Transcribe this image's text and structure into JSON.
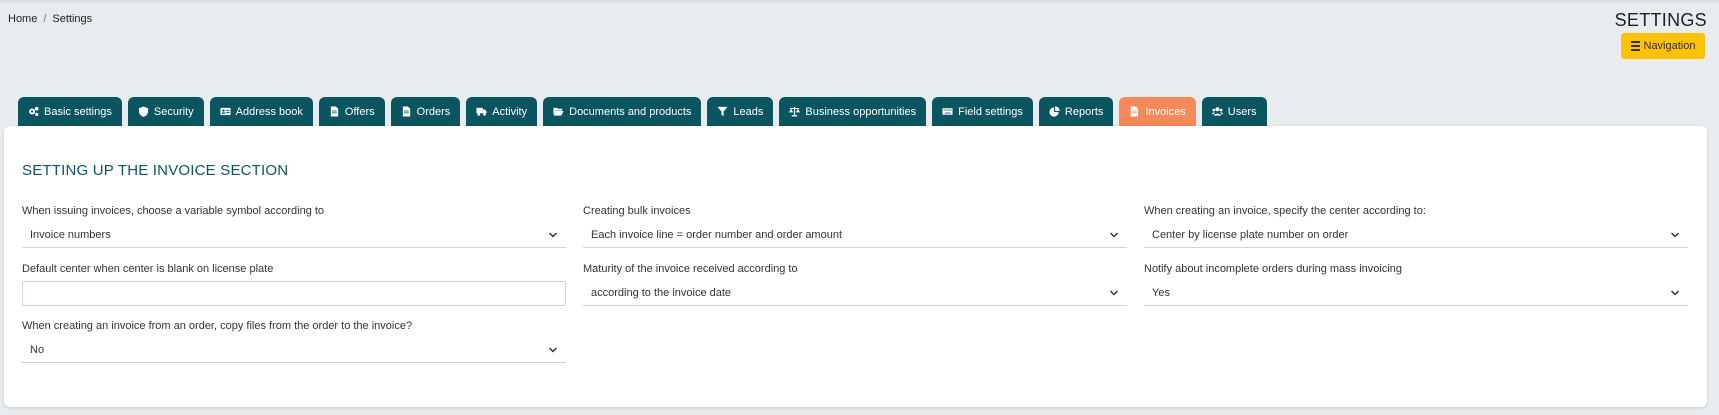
{
  "breadcrumb": {
    "home": "Home",
    "separator": "/",
    "current": "Settings"
  },
  "header": {
    "title": "SETTINGS",
    "navigation_label": "Navigation"
  },
  "tabs": [
    {
      "label": "Basic settings",
      "icon": "cogs-icon"
    },
    {
      "label": "Security",
      "icon": "shield-icon"
    },
    {
      "label": "Address book",
      "icon": "address-card-icon"
    },
    {
      "label": "Offers",
      "icon": "file-icon"
    },
    {
      "label": "Orders",
      "icon": "file-icon"
    },
    {
      "label": "Activity",
      "icon": "truck-icon"
    },
    {
      "label": "Documents and products",
      "icon": "folder-open-icon"
    },
    {
      "label": "Leads",
      "icon": "funnel-icon"
    },
    {
      "label": "Business opportunities",
      "icon": "balance-scale-icon"
    },
    {
      "label": "Field settings",
      "icon": "keyboard-icon"
    },
    {
      "label": "Reports",
      "icon": "pie-chart-icon"
    },
    {
      "label": "Invoices",
      "icon": "file-icon",
      "active": true
    },
    {
      "label": "Users",
      "icon": "users-icon"
    }
  ],
  "panel": {
    "title": "SETTING UP THE INVOICE SECTION",
    "fields": [
      {
        "label": "When issuing invoices, choose a variable symbol according to",
        "value": "Invoice numbers",
        "type": "select"
      },
      {
        "label": "Creating bulk invoices",
        "value": "Each invoice line = order number and order amount",
        "type": "select"
      },
      {
        "label": "When creating an invoice, specify the center according to:",
        "value": "Center by license plate number on order",
        "type": "select"
      },
      {
        "label": "Default center when center is blank on license plate",
        "value": "",
        "type": "text"
      },
      {
        "label": "Maturity of the invoice received according to",
        "value": "according to the invoice date",
        "type": "select"
      },
      {
        "label": "Notify about incomplete orders during mass invoicing",
        "value": "Yes",
        "type": "select"
      },
      {
        "label": "When creating an invoice from an order, copy files from the order to the invoice?",
        "value": "No",
        "type": "select"
      }
    ]
  },
  "colors": {
    "tab": "#0b5560",
    "tab_active": "#f6895a",
    "accent_button": "#ffc107",
    "title": "#0b5560"
  }
}
